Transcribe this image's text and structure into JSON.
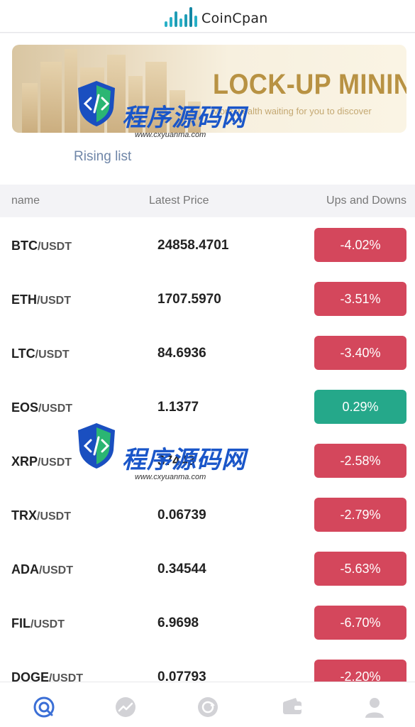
{
  "header": {
    "logo_text": "CoinCpan"
  },
  "banner": {
    "title": "LOCK-UP MINING",
    "subtitle": "More wealth waiting for you to discover"
  },
  "section_title": "Rising list",
  "columns": {
    "name": "name",
    "price": "Latest Price",
    "change": "Ups and Downs"
  },
  "colors": {
    "down": "#d4475c",
    "up": "#25a88a",
    "accent": "#3b6fd6"
  },
  "tickers": [
    {
      "base": "BTC",
      "quote": "/USDT",
      "price": "24858.4701",
      "change": "-4.02%",
      "direction": "down"
    },
    {
      "base": "ETH",
      "quote": "/USDT",
      "price": "1707.5970",
      "change": "-3.51%",
      "direction": "down"
    },
    {
      "base": "LTC",
      "quote": "/USDT",
      "price": "84.6936",
      "change": "-3.40%",
      "direction": "down"
    },
    {
      "base": "EOS",
      "quote": "/USDT",
      "price": "1.1377",
      "change": "0.29%",
      "direction": "up"
    },
    {
      "base": "XRP",
      "quote": "/USDT",
      "price": "37443",
      "change": "-2.58%",
      "direction": "down"
    },
    {
      "base": "TRX",
      "quote": "/USDT",
      "price": "0.06739",
      "change": "-2.79%",
      "direction": "down"
    },
    {
      "base": "ADA",
      "quote": "/USDT",
      "price": "0.34544",
      "change": "-5.63%",
      "direction": "down"
    },
    {
      "base": "FIL",
      "quote": "/USDT",
      "price": "6.9698",
      "change": "-6.70%",
      "direction": "down"
    },
    {
      "base": "DOGE",
      "quote": "/USDT",
      "price": "0.07793",
      "change": "-2.20%",
      "direction": "down"
    }
  ],
  "tabbar": {
    "items": [
      {
        "icon": "home-icon",
        "active": true
      },
      {
        "icon": "trend-icon",
        "active": false
      },
      {
        "icon": "trade-icon",
        "active": false
      },
      {
        "icon": "wallet-icon",
        "active": false
      },
      {
        "icon": "user-icon",
        "active": false
      }
    ]
  },
  "watermark": {
    "text": "程序源码网",
    "url": "www.cxyuanma.com"
  }
}
